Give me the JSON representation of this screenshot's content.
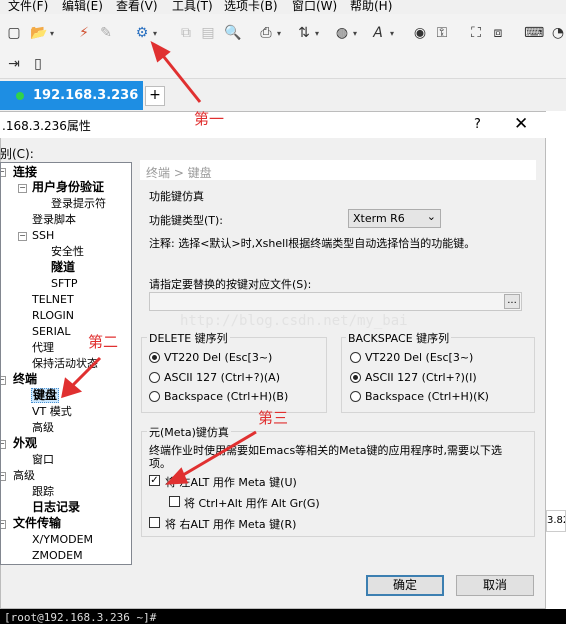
{
  "menu": [
    "文件(F)",
    "编辑(E)",
    "查看(V)",
    "工具(T)",
    "选项卡(B)",
    "窗口(W)",
    "帮助(H)"
  ],
  "tab": {
    "label": "192.168.3.236",
    "add": "+"
  },
  "dialog": {
    "title": ".168.3.236属性",
    "help": "?",
    "close": "✕",
    "category_label": "别(C):",
    "breadcrumb": "终端 > 键盘",
    "function_key_group": "功能键仿真",
    "function_key_type_label": "功能键类型(T):",
    "function_key_type_value": "Xterm R6",
    "note": "注释: 选择<默认>时,Xshell根据终端类型自动选择恰当的功能键。",
    "mapping_file_label": "请指定要替换的按键对应文件(S):",
    "mapping_file_value": "",
    "browse": "...",
    "delete_group": "DELETE 键序列",
    "delete_options": [
      "VT220 Del (Esc[3~)",
      "ASCII 127 (Ctrl+?)(A)",
      "Backspace (Ctrl+H)(B)"
    ],
    "delete_selected": 0,
    "backspace_group": "BACKSPACE 键序列",
    "backspace_options": [
      "VT220 Del (Esc[3~)",
      "ASCII 127 (Ctrl+?)(I)",
      "Backspace (Ctrl+H)(K)"
    ],
    "backspace_selected": 1,
    "meta_group": "元(Meta)键仿真",
    "meta_desc_line1": "终端作业时使用需要如Emacs等相关的Meta键的应用程序时,需要以下选",
    "meta_desc_line2": "项。",
    "meta_left_alt": "将 左ALT 用作 Meta 键(U)",
    "meta_left_alt_checked": true,
    "meta_ctrl_alt": "将 Ctrl+Alt 用作 Alt Gr(G)",
    "meta_ctrl_alt_checked": false,
    "meta_right_alt": "将 右ALT 用作 Meta 键(R)",
    "meta_right_alt_checked": false,
    "ok": "确定",
    "cancel": "取消"
  },
  "tree": {
    "connect": "连接",
    "auth": "用户身份验证",
    "login_prompt": "登录提示符",
    "login_script": "登录脚本",
    "ssh": "SSH",
    "security": "安全性",
    "tunnel": "隧道",
    "sftp": "SFTP",
    "telnet": "TELNET",
    "rlogin": "RLOGIN",
    "serial": "SERIAL",
    "proxy": "代理",
    "keepalive": "保持活动状态",
    "terminal": "终端",
    "keyboard": "键盘",
    "vt_mode": "VT 模式",
    "advanced": "高级",
    "appearance": "外观",
    "window": "窗口",
    "advanced2": "高级",
    "trace": "跟踪",
    "log": "日志记录",
    "file_transfer": "文件传输",
    "xymodem": "X/YMODEM",
    "zmodem": "ZMODEM"
  },
  "watermark": "http://blog.csdn.net/my_bai",
  "annotations": {
    "first": "第一",
    "second": "第二",
    "third": "第三"
  },
  "terminal_line": "[root@192.168.3.236 ~]#",
  "side_fragment": "3.82",
  "colors": {
    "tab_active": "#1e8ee3",
    "annotation": "#e03030",
    "default_button_border": "#3c7fb1"
  }
}
